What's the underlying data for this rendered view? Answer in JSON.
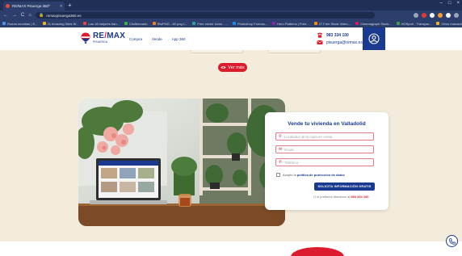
{
  "browser": {
    "tab_title": "RE/MAX Pisuerga 360º",
    "tab_close": "×",
    "new_tab": "+",
    "url": "remaxpisuerga360.es",
    "window_controls": [
      "–",
      "□",
      "×"
    ],
    "nav_icons": [
      "←",
      "→",
      "C",
      "⌂"
    ],
    "bookmarks": [
      {
        "label": "Rueda mundiau | E...",
        "color": "#4c8df6"
      },
      {
        "label": "21 Amazing Sites W...",
        "color": "#f2b227"
      },
      {
        "label": "Las 18 mejores ban...",
        "color": "#e94435"
      },
      {
        "label": "CircMercado",
        "color": "#3ab44a"
      },
      {
        "label": "RiviPNG - 60 png L...",
        "color": "#f47c20"
      },
      {
        "label": "Free vector icons - ...",
        "color": "#26a69a"
      },
      {
        "label": "Photoshop Formas...",
        "color": "#1e88e5"
      },
      {
        "label": "Hero Patterns | Free...",
        "color": "#8e24aa"
      },
      {
        "label": "27 Free Stock Video...",
        "color": "#fb8c00"
      },
      {
        "label": "Cinemagraph Stock...",
        "color": "#d81b60"
      },
      {
        "label": "HOSpotI - Transpar...",
        "color": "#43a047"
      }
    ],
    "bookmarks_other": "Otros marcadores",
    "extension_colors": [
      "#9aa5bd",
      "#e53935",
      "#f6f7fb",
      "#f29f2a",
      "#f6f7fb",
      "#9aa5bd"
    ]
  },
  "header": {
    "logo_main_1": "RE",
    "logo_slash": "/",
    "logo_main_2": "MAX",
    "logo_sub": "PISUERGA",
    "nav": [
      "Compra",
      "Vende",
      "App 360"
    ],
    "phone": "983 334 100",
    "email": "pisuerga@remax.es",
    "brand_blue": "#1a3a8f",
    "brand_red": "#dc1c2e"
  },
  "ver_mas": {
    "label": "Ver más",
    "icon": "eye-icon"
  },
  "form": {
    "title": "Vende tu vivienda en Valladolid",
    "fields": [
      {
        "icon": "location-pin-icon",
        "glyph": "⚲",
        "placeholder": "Localidad de la casa en venta"
      },
      {
        "icon": "envelope-icon",
        "glyph": "✉",
        "placeholder": "Email"
      },
      {
        "icon": "phone-icon",
        "glyph": "✆",
        "placeholder": "Teléfono"
      }
    ],
    "consent_prefix": "Acepto la",
    "consent_link": "política de protección de datos",
    "submit": "SOLICITA INFORMACIÓN GRATIS",
    "callback_prefix": "O si prefieres llámanos al",
    "callback_phone": "983 334 100"
  }
}
